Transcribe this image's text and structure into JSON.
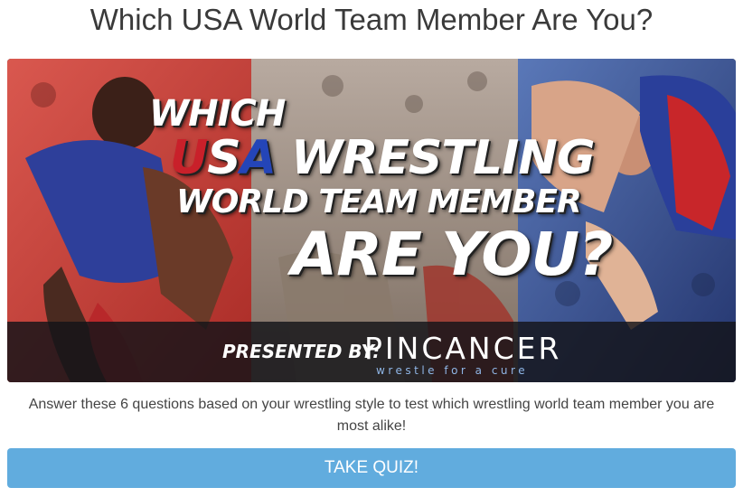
{
  "page": {
    "title": "Which USA World Team Member Are You?"
  },
  "hero": {
    "line1": "WHICH",
    "usa_u": "U",
    "usa_s": "S",
    "usa_a": "A",
    "line2_rest": " WRESTLING",
    "line3": "WORLD TEAM MEMBER",
    "line4": "ARE YOU?",
    "presented_label": "PRESENTED BY:",
    "brand_name": "PINCANCER",
    "brand_tagline": "wrestle for a cure",
    "colors": {
      "red": "#c9202a",
      "blue": "#2445b8",
      "white": "#ffffff"
    }
  },
  "description": "Answer these 6 questions based on your wrestling style to test which wrestling world team member you are most alike!",
  "cta": {
    "label": "TAKE QUIZ!",
    "color": "#61acde"
  }
}
